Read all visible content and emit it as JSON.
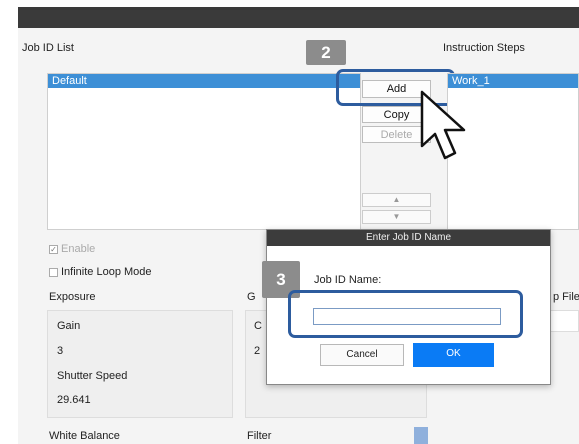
{
  "job_panel": {
    "title": "Job ID List",
    "items": [
      "Default"
    ],
    "buttons": {
      "add": "Add",
      "copy": "Copy",
      "delete": "Delete",
      "up": "▲",
      "down": "▼"
    },
    "enable_label": "Enable",
    "enable_checked": true,
    "infinite_loop_label": "Infinite Loop Mode",
    "infinite_loop_checked": false
  },
  "instruction_panel": {
    "title": "Instruction Steps",
    "items": [
      "Work_1"
    ],
    "partial_label": "p File"
  },
  "camera": {
    "exposure_title": "Exposure",
    "gain_label": "Gain",
    "gain_value": "3",
    "shutter_label": "Shutter Speed",
    "shutter_value": "29.641",
    "second_title_partial": "G",
    "second_label_partial": "C",
    "second_value_partial": "2",
    "white_balance_title": "White Balance",
    "filter_title": "Filter"
  },
  "steps": {
    "step2": "2",
    "step3": "3"
  },
  "dialog": {
    "title": "Enter Job ID Name",
    "field_label": "Job ID Name:",
    "field_value": "",
    "cancel": "Cancel",
    "ok": "OK"
  },
  "colors": {
    "highlight": "#2d5c9e",
    "selection": "#3d8fd6",
    "ok_button": "#0a7bf5",
    "badge": "#8c8c8c"
  }
}
